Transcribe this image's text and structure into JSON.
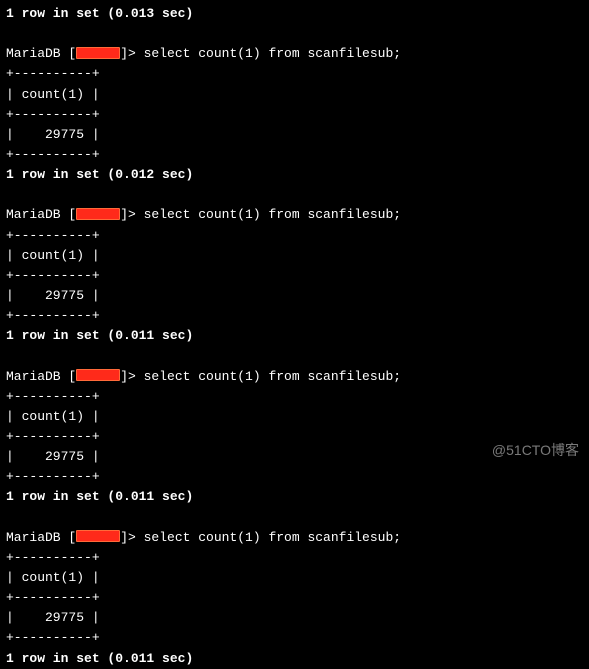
{
  "watermark": "@51CTO博客",
  "prompt_prefix": "MariaDB [",
  "prompt_suffix": "]> ",
  "sql_command": "select count(1) from scanfilesub;",
  "table_border": "+----------+",
  "table_header": "| count(1) |",
  "result_row": "|    29775 |",
  "summary_prefix": "1 row in set (",
  "summary_suffix": " sec)",
  "queries": [
    {
      "time": "0.013"
    },
    {
      "time": "0.012"
    },
    {
      "time": "0.011"
    },
    {
      "time": "0.011"
    },
    {
      "time": "0.011"
    }
  ]
}
